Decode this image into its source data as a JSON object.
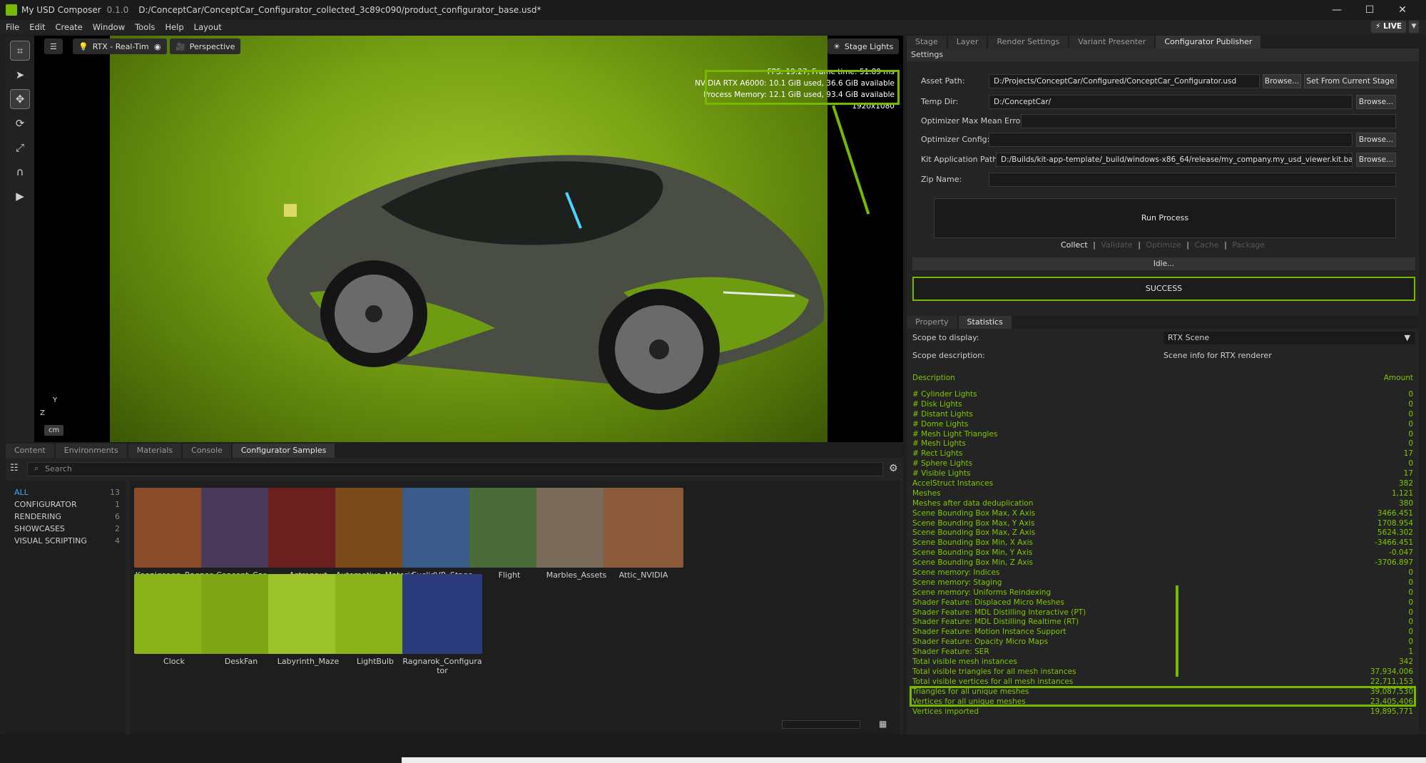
{
  "app": {
    "name": "My USD Composer",
    "version": "0.1.0",
    "path": "D:/ConceptCar/ConceptCar_Configurator_collected_3c89c090/product_configurator_base.usd*"
  },
  "window_controls": [
    "—",
    "☐",
    "✕"
  ],
  "menu": [
    "File",
    "Edit",
    "Create",
    "Window",
    "Tools",
    "Help",
    "Layout"
  ],
  "live": "⚡ LIVE",
  "viewport": {
    "renderer": "RTX - Real-Time",
    "camera": "Perspective",
    "stage_lights": "Stage Lights",
    "fps": "FPS: 19.27, Frame time: 51.89 ms",
    "gpu": "NVIDIA RTX A6000: 10.1 GiB used, 36.6 GiB available",
    "process_memory": "Process Memory: 12.1 GiB used, 93.4 GiB available",
    "resolution": "1920x1080",
    "units": "cm",
    "axis_y": "Y",
    "axis_z": "Z"
  },
  "right_tabs": [
    "Stage",
    "Layer",
    "Render Settings",
    "Variant Presenter",
    "Configurator Publisher"
  ],
  "settings": {
    "header": "Settings",
    "asset_path_label": "Asset Path:",
    "asset_path": "D:/Projects/ConceptCar/Configured/ConceptCar_Configurator.usd",
    "temp_dir_label": "Temp Dir:",
    "temp_dir": "D:/ConceptCar/",
    "optimizer_error_label": "Optimizer Max Mean Error:",
    "optimizer_config_label": "Optimizer Config:",
    "kit_path_label": "Kit Application Path:",
    "kit_path": "D:/Builds/kit-app-template/_build/windows-x86_64/release/my_company.my_usd_viewer.kit.bat",
    "zip_label": "Zip Name:",
    "browse": "Browse...",
    "set_from_stage": "Set From Current Stage",
    "run": "Run Process",
    "steps": [
      "Collect",
      "Validate",
      "Optimize",
      "Cache",
      "Package"
    ],
    "sep": "|",
    "idle": "Idle...",
    "success": "SUCCESS"
  },
  "stat_tabs": [
    "Property",
    "Statistics"
  ],
  "statistics": {
    "scope_label": "Scope to display:",
    "scope": "RTX Scene",
    "desc_label": "Scope description:",
    "desc": "Scene info for RTX renderer",
    "col_desc": "Description",
    "col_amount": "Amount",
    "rows": [
      [
        "# Cylinder Lights",
        "0"
      ],
      [
        "# Disk Lights",
        "0"
      ],
      [
        "# Distant Lights",
        "0"
      ],
      [
        "# Dome Lights",
        "0"
      ],
      [
        "# Mesh Light Triangles",
        "0"
      ],
      [
        "# Mesh Lights",
        "0"
      ],
      [
        "# Rect Lights",
        "17"
      ],
      [
        "# Sphere Lights",
        "0"
      ],
      [
        "# Visible Lights",
        "17"
      ],
      [
        "AccelStruct Instances",
        "382"
      ],
      [
        "Meshes",
        "1,121"
      ],
      [
        "Meshes after data deduplication",
        "380"
      ],
      [
        "Scene Bounding Box Max, X Axis",
        "3466.451"
      ],
      [
        "Scene Bounding Box Max, Y Axis",
        "1708.954"
      ],
      [
        "Scene Bounding Box Max, Z Axis",
        "5624.302"
      ],
      [
        "Scene Bounding Box Min, X Axis",
        "-3466.451"
      ],
      [
        "Scene Bounding Box Min, Y Axis",
        "-0.047"
      ],
      [
        "Scene Bounding Box Min, Z Axis",
        "-3706.897"
      ],
      [
        "Scene memory: Indices",
        "0"
      ],
      [
        "Scene memory: Staging",
        "0"
      ],
      [
        "Scene memory: Uniforms Reindexing",
        "0"
      ],
      [
        "Shader Feature: Displaced Micro Meshes",
        "0"
      ],
      [
        "Shader Feature: MDL Distilling Interactive (PT)",
        "0"
      ],
      [
        "Shader Feature: MDL Distilling Realtime (RT)",
        "0"
      ],
      [
        "Shader Feature: Motion Instance Support",
        "0"
      ],
      [
        "Shader Feature: Opacity Micro Maps",
        "0"
      ],
      [
        "Shader Feature: SER",
        "1"
      ],
      [
        "Total visible mesh instances",
        "342"
      ],
      [
        "Total visible triangles for all mesh instances",
        "37,934,006"
      ],
      [
        "Total visible vertices for all mesh instances",
        "22,711,153"
      ],
      [
        "Triangles for all unique meshes",
        "39,087,530"
      ],
      [
        "Vertices for all unique meshes",
        "23,405,406"
      ],
      [
        "Vertices imported",
        "19,895,771"
      ]
    ]
  },
  "bottom_tabs": [
    "Content",
    "Environments",
    "Materials",
    "Console",
    "Configurator Samples"
  ],
  "search_placeholder": "Search",
  "categories": [
    [
      "ALL",
      "13"
    ],
    [
      "CONFIGURATOR",
      "1"
    ],
    [
      "RENDERING",
      "6"
    ],
    [
      "SHOWCASES",
      "2"
    ],
    [
      "VISUAL SCRIPTING",
      "4"
    ]
  ],
  "samples": [
    "Koenigsegg_Ragnarok",
    "Concept_Car",
    "Astronaut",
    "Automotive_Material_Library_Pristine",
    "EuclidVR_Stage",
    "Flight",
    "Marbles_Assets",
    "Attic_NVIDIA",
    "Clock",
    "DeskFan",
    "Labyrinth_Maze",
    "LightBulb",
    "Ragnarok_Configurator"
  ],
  "colors": {
    "accent": "#76b900",
    "stat_text": "#7fc800"
  },
  "icons": [
    "logo-icon",
    "search-icon",
    "gear-icon",
    "select-icon",
    "move-icon",
    "rotate-icon",
    "scale-icon",
    "snap-icon",
    "play-icon",
    "sun-icon",
    "camera-icon",
    "eye-icon",
    "light-icon",
    "settings-icon",
    "dropdown-icon",
    "grid-view-icon"
  ]
}
